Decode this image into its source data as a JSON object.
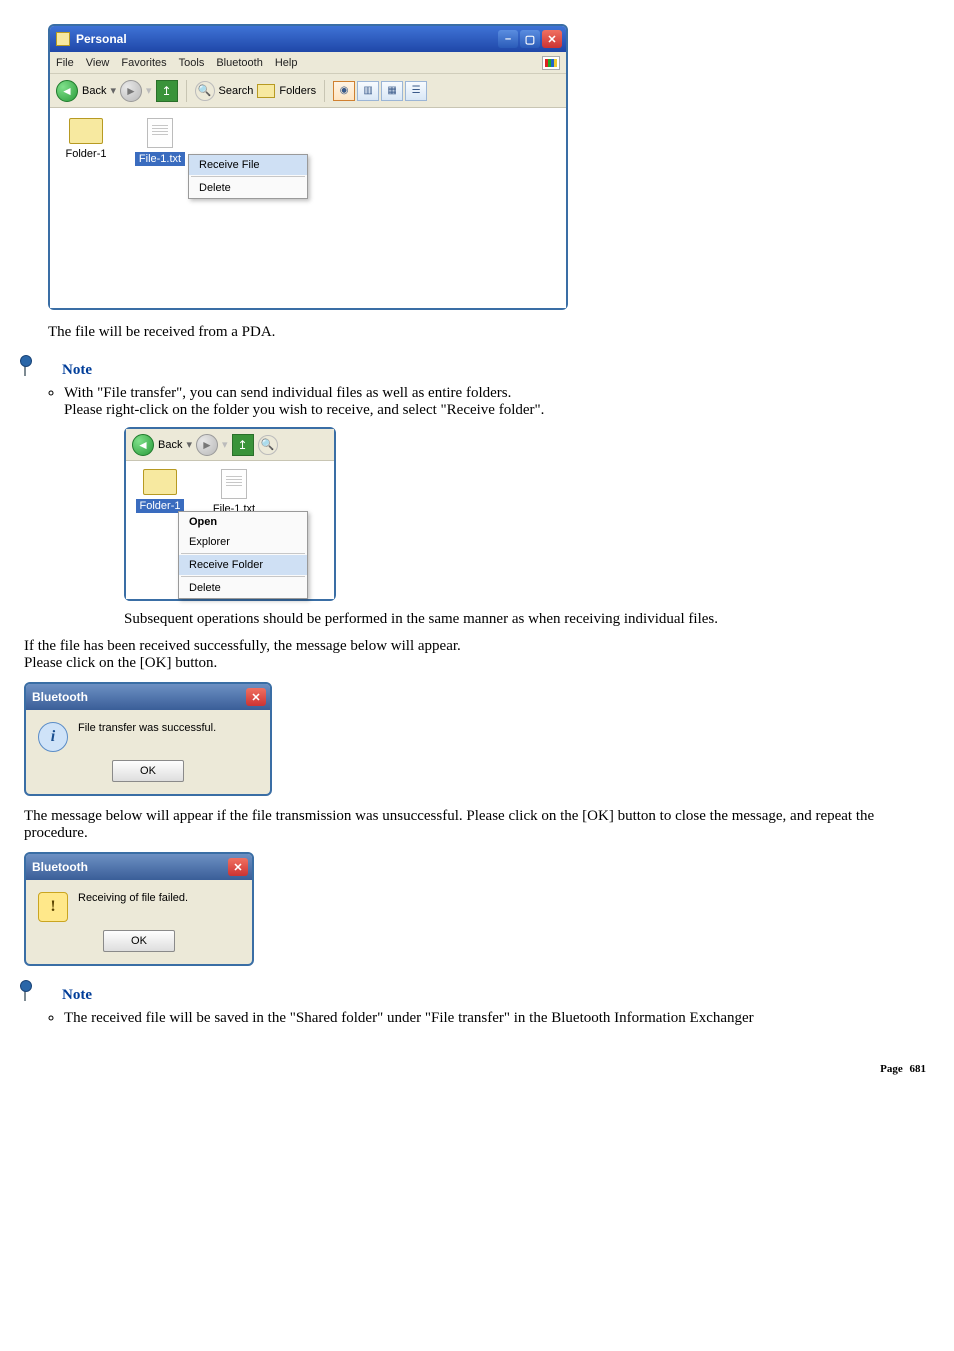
{
  "explorer": {
    "title": "Personal",
    "menu": [
      "File",
      "View",
      "Favorites",
      "Tools",
      "Bluetooth",
      "Help"
    ],
    "toolbar": {
      "back": "Back",
      "search": "Search",
      "folders": "Folders"
    },
    "items": [
      {
        "name": "Folder-1"
      },
      {
        "name": "File-1.txt"
      }
    ],
    "context": {
      "receive_file": "Receive File",
      "delete": "Delete"
    }
  },
  "body_text": {
    "p1": "The file will be received from a PDA.",
    "note1_label": "Note",
    "note1_li_a": "With \"File transfer\", you can send individual files as well as entire folders.",
    "note1_li_b": "Please right-click on the folder you wish to receive, and select \"Receive folder\".",
    "p_subsequent": "Subsequent operations should be performed in the same manner as when receiving individual files.",
    "p_success_a": "If the file has been received successfully, the message below will appear.",
    "p_success_b": "Please click on the [OK] button.",
    "p_fail": "The message below will appear if the file transmission was unsuccessful. Please click on the [OK] button to close the message, and repeat the procedure.",
    "note2_label": "Note",
    "note2_li_a": "The received file will be saved in the \"Shared folder\" under \"File transfer\" in the Bluetooth Information Exchanger"
  },
  "small_explorer": {
    "toolbar": {
      "back": "Back"
    },
    "items": [
      {
        "name": "Folder-1"
      },
      {
        "name": "File-1.txt"
      }
    ],
    "context": {
      "open": "Open",
      "explorer": "Explorer",
      "receive_folder": "Receive Folder",
      "delete": "Delete"
    }
  },
  "dialog_success": {
    "title": "Bluetooth",
    "msg": "File transfer was successful.",
    "ok": "OK"
  },
  "dialog_fail": {
    "title": "Bluetooth",
    "msg": "Receiving of file failed.",
    "ok": "OK"
  },
  "page": {
    "label": "Page",
    "number": "681"
  }
}
